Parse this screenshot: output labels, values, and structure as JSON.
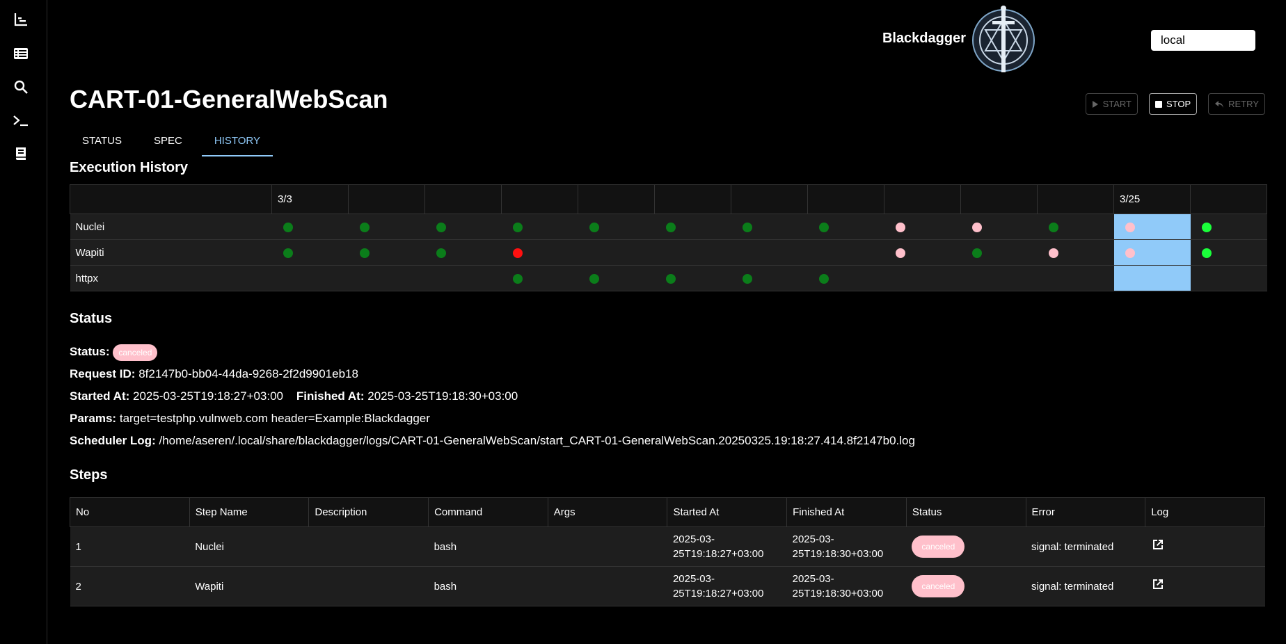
{
  "sidebar": {
    "items": [
      {
        "icon": "timeline-chart-icon"
      },
      {
        "icon": "list-icon"
      },
      {
        "icon": "search-icon"
      },
      {
        "icon": "terminal-icon"
      },
      {
        "icon": "book-icon"
      }
    ]
  },
  "header": {
    "brand": "Blackdagger",
    "env_value": "local"
  },
  "page": {
    "title": "CART-01-GeneralWebScan",
    "actions": {
      "start": "START",
      "stop": "STOP",
      "retry": "RETRY"
    },
    "tabs": [
      "STATUS",
      "SPEC",
      "HISTORY"
    ],
    "active_tab": "HISTORY"
  },
  "history": {
    "heading": "Execution History",
    "columns": [
      "3/3",
      "",
      "",
      "",
      "",
      "",
      "",
      "",
      "",
      "",
      "",
      "3/25",
      ""
    ],
    "highlight_column": 11,
    "colors": {
      "success": "#0b7d1a",
      "canceled": "#ffc0cb",
      "failed": "#ff1010",
      "running": "#1aff3a",
      "highlight": "#90caf9"
    },
    "rows": [
      {
        "name": "Nuclei",
        "cells": [
          "success",
          "success",
          "success",
          "success",
          "success",
          "success",
          "success",
          "success",
          "canceled",
          "canceled",
          "success",
          "canceled",
          "running"
        ]
      },
      {
        "name": "Wapiti",
        "cells": [
          "success",
          "success",
          "success",
          "failed",
          "",
          "",
          "",
          "",
          "canceled",
          "success",
          "canceled",
          "canceled",
          "running"
        ]
      },
      {
        "name": "httpx",
        "cells": [
          "",
          "",
          "",
          "success",
          "success",
          "success",
          "success",
          "success",
          "",
          "",
          "",
          "",
          ""
        ]
      }
    ]
  },
  "status": {
    "heading": "Status",
    "status_label": "Status:",
    "status_value": "canceled",
    "request_id_label": "Request ID:",
    "request_id": "8f2147b0-bb04-44da-9268-2f2d9901eb18",
    "started_label": "Started At:",
    "started_at": "2025-03-25T19:18:27+03:00",
    "finished_label": "Finished At:",
    "finished_at": "2025-03-25T19:18:30+03:00",
    "params_label": "Params:",
    "params": "target=testphp.vulnweb.com header=Example:Blackdagger",
    "log_label": "Scheduler Log:",
    "log_path": "/home/aseren/.local/share/blackdagger/logs/CART-01-GeneralWebScan/start_CART-01-GeneralWebScan.20250325.19:18:27.414.8f2147b0.log"
  },
  "steps": {
    "heading": "Steps",
    "columns": [
      "No",
      "Step Name",
      "Description",
      "Command",
      "Args",
      "Started At",
      "Finished At",
      "Status",
      "Error",
      "Log"
    ],
    "rows": [
      {
        "no": "1",
        "name": "Nuclei",
        "description": "",
        "command": "bash",
        "args": "",
        "started_a": "2025-03-",
        "started_b": "25T19:18:27+03:00",
        "finished_a": "2025-03-",
        "finished_b": "25T19:18:30+03:00",
        "status": "canceled",
        "error": "signal: terminated"
      },
      {
        "no": "2",
        "name": "Wapiti",
        "description": "",
        "command": "bash",
        "args": "",
        "started_a": "2025-03-",
        "started_b": "25T19:18:27+03:00",
        "finished_a": "2025-03-",
        "finished_b": "25T19:18:30+03:00",
        "status": "canceled",
        "error": "signal: terminated"
      }
    ]
  }
}
